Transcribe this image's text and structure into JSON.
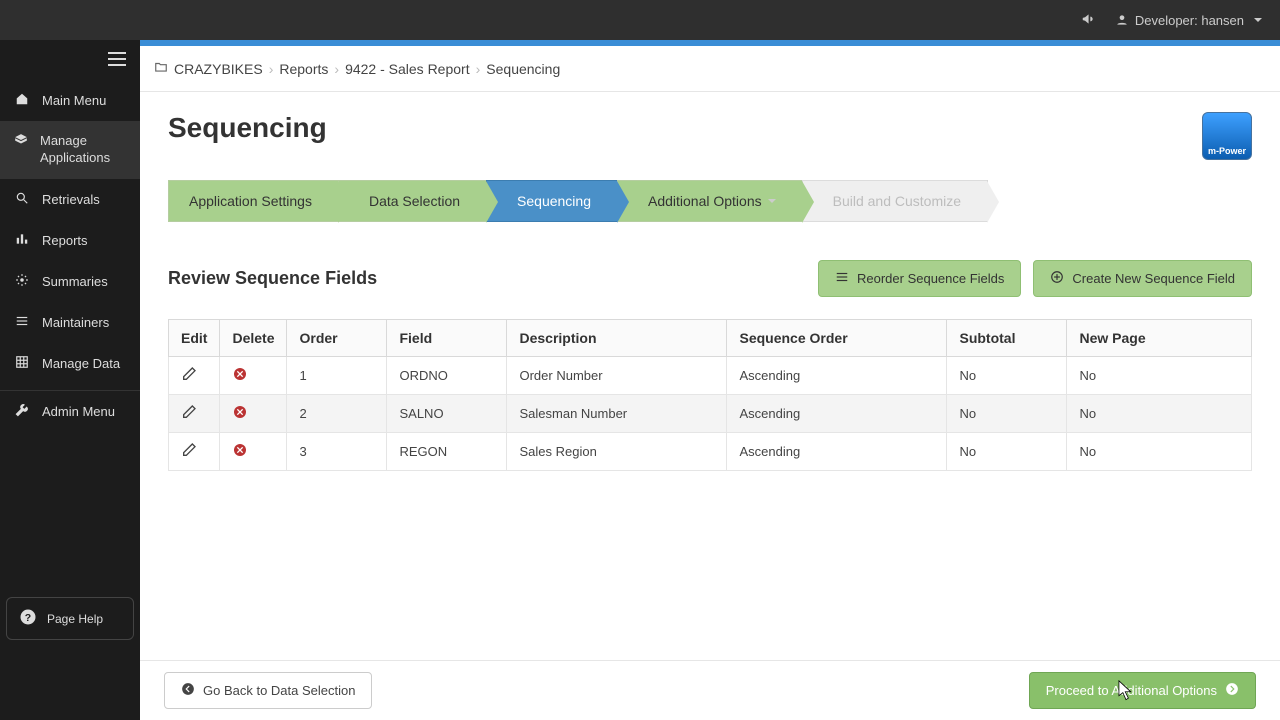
{
  "topbar": {
    "user_label": "Developer: hansen"
  },
  "sidebar": {
    "items": [
      {
        "label": "Main Menu",
        "icon": "home"
      },
      {
        "label": "Manage Applications",
        "icon": "layers",
        "active": true
      },
      {
        "label": "Retrievals",
        "icon": "search"
      },
      {
        "label": "Reports",
        "icon": "bar-chart"
      },
      {
        "label": "Summaries",
        "icon": "gear"
      },
      {
        "label": "Maintainers",
        "icon": "list"
      },
      {
        "label": "Manage Data",
        "icon": "grid"
      },
      {
        "label": "Admin Menu",
        "icon": "wrench"
      }
    ],
    "page_help": "Page Help"
  },
  "breadcrumbs": [
    "CRAZYBIKES",
    "Reports",
    "9422 - Sales Report",
    "Sequencing"
  ],
  "page_title": "Sequencing",
  "logo_text": "m-Power",
  "steps": {
    "app_settings": "Application Settings",
    "data_selection": "Data Selection",
    "sequencing": "Sequencing",
    "additional": "Additional Options",
    "build": "Build and Customize"
  },
  "subheader": "Review Sequence Fields",
  "buttons": {
    "reorder": "Reorder Sequence Fields",
    "create": "Create New Sequence Field",
    "back": "Go Back to Data Selection",
    "proceed": "Proceed to Additional Options"
  },
  "table": {
    "headers": [
      "Edit",
      "Delete",
      "Order",
      "Field",
      "Description",
      "Sequence Order",
      "Subtotal",
      "New Page"
    ],
    "rows": [
      {
        "order": "1",
        "field": "ORDNO",
        "desc": "Order Number",
        "seq": "Ascending",
        "subtotal": "No",
        "newpage": "No"
      },
      {
        "order": "2",
        "field": "SALNO",
        "desc": "Salesman Number",
        "seq": "Ascending",
        "subtotal": "No",
        "newpage": "No"
      },
      {
        "order": "3",
        "field": "REGON",
        "desc": "Sales Region",
        "seq": "Ascending",
        "subtotal": "No",
        "newpage": "No"
      }
    ]
  }
}
